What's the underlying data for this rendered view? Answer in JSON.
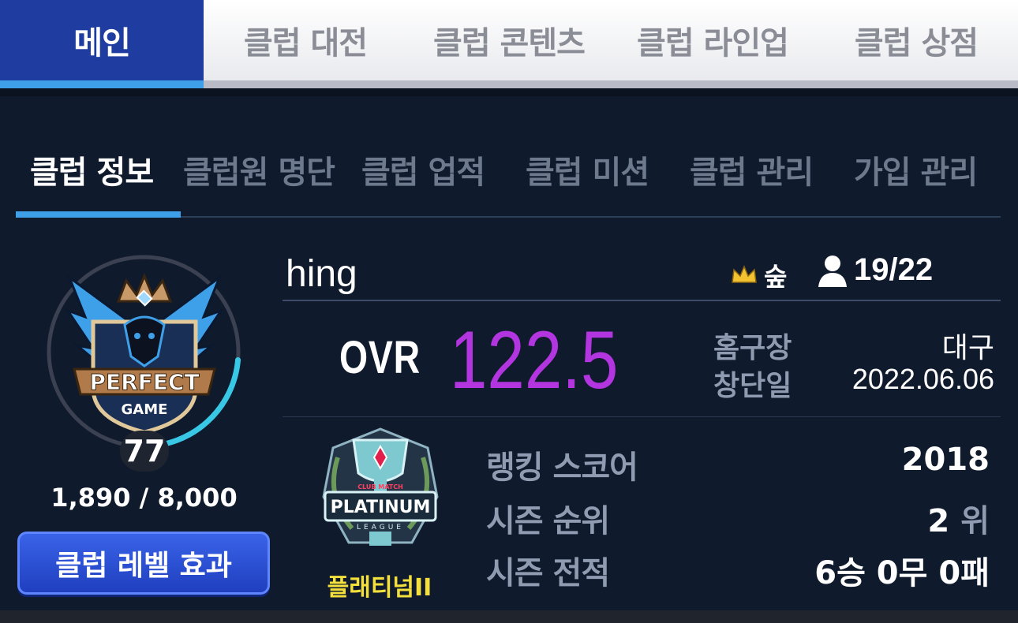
{
  "top_nav": {
    "tabs": [
      "메인",
      "클럽 대전",
      "클럽 콘텐츠",
      "클럽 라인업",
      "클럽 상점"
    ],
    "active_index": 0
  },
  "sub_tabs": {
    "tabs": [
      "클럽 정보",
      "클럽원 명단",
      "클럽 업적",
      "클럽 미션",
      "클럽 관리",
      "가입 관리"
    ],
    "active_index": 0
  },
  "club": {
    "name": "hing",
    "leader": "숲",
    "members": "19/22",
    "ovr_label": "OVR",
    "ovr_value": "122.5",
    "home_label": "홈구장",
    "home_value": "대구",
    "founded_label": "창단일",
    "founded_value": "2022.06.06",
    "emblem_text_1": "PERFECT",
    "emblem_text_2": "GAME"
  },
  "level": {
    "value": "77",
    "exp": "1,890 / 8,000",
    "exp_progress": 0.236,
    "button_label": "클럽 레벨 효과"
  },
  "league": {
    "tier_name": "플래티넘II",
    "badge_small": "CLUB MATCH",
    "badge_text": "PLATINUM",
    "badge_sub": "LEAGUE"
  },
  "stats": {
    "ranking_label": "랭킹 스코어",
    "ranking_value": "2018",
    "season_rank_label": "시즌 순위",
    "season_rank_value": "2",
    "season_rank_unit": "위",
    "season_record_label": "시즌 전적",
    "season_record_value": "6승 0무 0패"
  },
  "colors": {
    "accent_blue": "#3fa0ea",
    "ovr_purple": "#b235e0",
    "tier_yellow": "#f4e03c",
    "button_blue": "#2a4fd6",
    "crown_gold": "#f2c230"
  },
  "icons": [
    "crown-icon",
    "person-icon"
  ]
}
